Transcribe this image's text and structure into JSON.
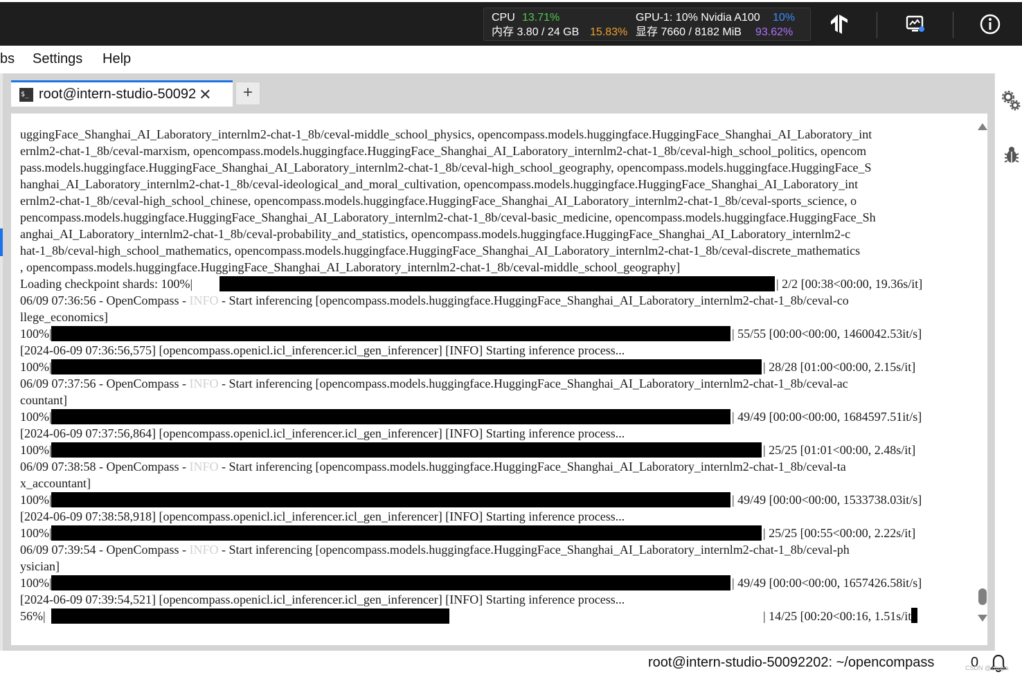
{
  "topbar": {
    "cpu_label": "CPU",
    "cpu_value": "13.71%",
    "mem_label": "内存 3.80 / 24 GB",
    "mem_value": "15.83%",
    "gpu_label": "GPU-1: 10% Nvidia A100",
    "gpu_value": "10%",
    "vram_label": "显存 7660 / 8182 MiB",
    "vram_value": "93.62%",
    "icons": [
      "tensorflow-icon",
      "monitor-icon",
      "info-icon"
    ]
  },
  "menu": {
    "items": [
      "bs",
      "Settings",
      "Help"
    ]
  },
  "tab": {
    "icon": "terminal-icon",
    "label": "root@intern-studio-50092",
    "close": "✕",
    "add": "+"
  },
  "terminal": {
    "text_lines": [
      "uggingFace_Shanghai_AI_Laboratory_internlm2-chat-1_8b/ceval-middle_school_physics, opencompass.models.huggingface.HuggingFace_Shanghai_AI_Laboratory_int",
      "ernlm2-chat-1_8b/ceval-marxism, opencompass.models.huggingface.HuggingFace_Shanghai_AI_Laboratory_internlm2-chat-1_8b/ceval-high_school_politics, opencom",
      "pass.models.huggingface.HuggingFace_Shanghai_AI_Laboratory_internlm2-chat-1_8b/ceval-high_school_geography, opencompass.models.huggingface.HuggingFace_S",
      "hanghai_AI_Laboratory_internlm2-chat-1_8b/ceval-ideological_and_moral_cultivation, opencompass.models.huggingface.HuggingFace_Shanghai_AI_Laboratory_int",
      "ernlm2-chat-1_8b/ceval-high_school_chinese, opencompass.models.huggingface.HuggingFace_Shanghai_AI_Laboratory_internlm2-chat-1_8b/ceval-sports_science, o",
      "pencompass.models.huggingface.HuggingFace_Shanghai_AI_Laboratory_internlm2-chat-1_8b/ceval-basic_medicine, opencompass.models.huggingface.HuggingFace_Sh",
      "anghai_AI_Laboratory_internlm2-chat-1_8b/ceval-probability_and_statistics, opencompass.models.huggingface.HuggingFace_Shanghai_AI_Laboratory_internlm2-c",
      "hat-1_8b/ceval-high_school_mathematics, opencompass.models.huggingface.HuggingFace_Shanghai_AI_Laboratory_internlm2-chat-1_8b/ceval-discrete_mathematics",
      ", opencompass.models.huggingface.HuggingFace_Shanghai_AI_Laboratory_internlm2-chat-1_8b/ceval-middle_school_geography]"
    ],
    "loading": {
      "pct": "Loading checkpoint shards: 100%|",
      "tail": "| 2/2 [00:38<00:00, 19.36s/it]"
    },
    "info_tag": "INFO",
    "blocks": [
      {
        "start_prefix": "06/09 07:36:56 - OpenCompass - ",
        "start_suffix": " - Start inferencing [opencompass.models.huggingface.HuggingFace_Shanghai_AI_Laboratory_internlm2-chat-1_8b/ceval-co",
        "start_wrap": "llege_economics]",
        "bar1": {
          "pct": "100%|",
          "tail": "| 55/55 [00:00<00:00, 1460042.53it/s]"
        },
        "infer": "[2024-06-09 07:36:56,575] [opencompass.openicl.icl_inferencer.icl_gen_inferencer] [INFO] Starting inference process...",
        "bar2": {
          "pct": "100%|",
          "tail": "| 28/28 [01:00<00:00,  2.15s/it]"
        }
      },
      {
        "start_prefix": "06/09 07:37:56 - OpenCompass - ",
        "start_suffix": " - Start inferencing [opencompass.models.huggingface.HuggingFace_Shanghai_AI_Laboratory_internlm2-chat-1_8b/ceval-ac",
        "start_wrap": "countant]",
        "bar1": {
          "pct": "100%|",
          "tail": "| 49/49 [00:00<00:00, 1684597.51it/s]"
        },
        "infer": "[2024-06-09 07:37:56,864] [opencompass.openicl.icl_inferencer.icl_gen_inferencer] [INFO] Starting inference process...",
        "bar2": {
          "pct": "100%|",
          "tail": "| 25/25 [01:01<00:00,  2.48s/it]"
        }
      },
      {
        "start_prefix": "06/09 07:38:58 - OpenCompass - ",
        "start_suffix": " - Start inferencing [opencompass.models.huggingface.HuggingFace_Shanghai_AI_Laboratory_internlm2-chat-1_8b/ceval-ta",
        "start_wrap": "x_accountant]",
        "bar1": {
          "pct": "100%|",
          "tail": "| 49/49 [00:00<00:00, 1533738.03it/s]"
        },
        "infer": "[2024-06-09 07:38:58,918] [opencompass.openicl.icl_inferencer.icl_gen_inferencer] [INFO] Starting inference process...",
        "bar2": {
          "pct": "100%|",
          "tail": "| 25/25 [00:55<00:00,  2.22s/it]"
        }
      },
      {
        "start_prefix": "06/09 07:39:54 - OpenCompass - ",
        "start_suffix": " - Start inferencing [opencompass.models.huggingface.HuggingFace_Shanghai_AI_Laboratory_internlm2-chat-1_8b/ceval-ph",
        "start_wrap": "ysician]",
        "bar1": {
          "pct": "100%|",
          "tail": "| 49/49 [00:00<00:00, 1657426.58it/s]"
        },
        "infer": "[2024-06-09 07:39:54,521] [opencompass.openicl.icl_inferencer.icl_gen_inferencer] [INFO] Starting inference process...",
        "bar2": {
          "pct": " 56%|",
          "tail": "| 14/25 [00:20<00:16,  1.51s/it",
          "progress": 0.56
        }
      }
    ]
  },
  "status": {
    "path": "root@intern-studio-50092202: ~/opencompass",
    "count": "0",
    "watermark": "CSDN @zhuijia"
  }
}
